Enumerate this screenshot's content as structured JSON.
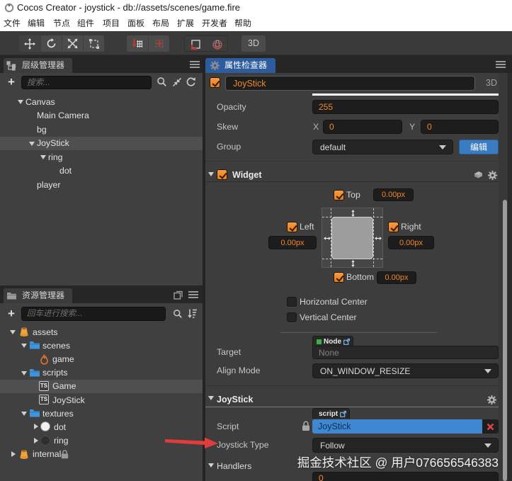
{
  "window": {
    "title": "Cocos Creator - joystick - db://assets/scenes/game.fire"
  },
  "menu": {
    "items": [
      "文件",
      "编辑",
      "节点",
      "组件",
      "项目",
      "面板",
      "布局",
      "扩展",
      "开发者",
      "帮助"
    ]
  },
  "toolbar": {
    "mode": "3D"
  },
  "hierarchy": {
    "tab": "层级管理器",
    "search_placeholder": "搜索...",
    "nodes": [
      {
        "label": "Canvas",
        "expanded": true
      },
      {
        "label": "Main Camera"
      },
      {
        "label": "bg"
      },
      {
        "label": "JoyStick",
        "expanded": true,
        "selected": true
      },
      {
        "label": "ring",
        "expanded": true
      },
      {
        "label": "dot"
      },
      {
        "label": "player"
      }
    ]
  },
  "assets": {
    "tab": "资源管理器",
    "search_placeholder": "回车进行搜索...",
    "items": [
      {
        "label": "assets",
        "type": "db",
        "expanded": true
      },
      {
        "label": "scenes",
        "type": "folder",
        "expanded": true
      },
      {
        "label": "game",
        "type": "scene"
      },
      {
        "label": "scripts",
        "type": "folder",
        "expanded": true
      },
      {
        "label": "Game",
        "type": "typescript",
        "selected": true
      },
      {
        "label": "JoyStick",
        "type": "typescript"
      },
      {
        "label": "textures",
        "type": "folder",
        "expanded": true
      },
      {
        "label": "dot",
        "type": "image"
      },
      {
        "label": "ring",
        "type": "image"
      },
      {
        "label": "internal",
        "type": "db",
        "locked": true
      }
    ]
  },
  "inspector": {
    "tab": "属性检查器",
    "node_name": "JoyStick",
    "mode": "3D",
    "opacity": {
      "label": "Opacity",
      "value": "255"
    },
    "skew": {
      "label": "Skew",
      "x_label": "X",
      "x": "0",
      "y_label": "Y",
      "y": "0"
    },
    "group": {
      "label": "Group",
      "value": "default",
      "edit": "编辑"
    },
    "widget": {
      "title": "Widget",
      "top": {
        "label": "Top",
        "value": "0.00px"
      },
      "left": {
        "label": "Left",
        "value": "0.00px"
      },
      "right": {
        "label": "Right",
        "value": "0.00px"
      },
      "bottom": {
        "label": "Bottom",
        "value": "0.00px"
      },
      "h_center": "Horizontal Center",
      "v_center": "Vertical Center",
      "target": {
        "label": "Target",
        "type": "Node",
        "value": "None"
      },
      "align_mode": {
        "label": "Align Mode",
        "value": "ON_WINDOW_RESIZE"
      }
    },
    "joystick": {
      "title": "JoyStick",
      "script": {
        "label": "Script",
        "type": "script",
        "value": "JoyStick"
      },
      "type": {
        "label": "Joystick Type",
        "value": "Follow"
      },
      "handlers": {
        "title": "Handlers",
        "value": "0"
      }
    }
  },
  "watermark": "掘金技术社区 @ 用户076656546383",
  "colors": {
    "accent_orange": "#f0872b",
    "tab_blue": "#2d5c9e",
    "script_blue": "#3f88d1",
    "edit_blue": "#3a7cc2",
    "arrow_red": "#e23b3b"
  }
}
